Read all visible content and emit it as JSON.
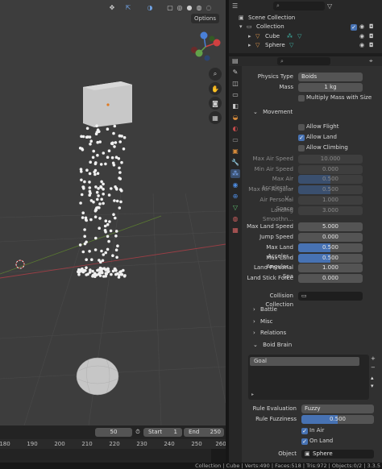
{
  "viewport": {
    "options_label": "Options"
  },
  "timeline": {
    "current_frame": "50",
    "start_label": "Start",
    "start_value": "1",
    "end_label": "End",
    "end_value": "250",
    "ticks": [
      "180",
      "190",
      "200",
      "210",
      "220",
      "230",
      "240",
      "250",
      "260"
    ]
  },
  "outliner": {
    "scene_collection": "Scene Collection",
    "collection": "Collection",
    "cube": "Cube",
    "sphere": "Sphere"
  },
  "properties": {
    "physics_type_label": "Physics Type",
    "physics_type_value": "Boids",
    "mass_label": "Mass",
    "mass_value": "1 kg",
    "multiply_mass": "Multiply Mass with Size",
    "movement_label": "Movement",
    "allow_flight": "Allow Flight",
    "allow_land": "Allow Land",
    "allow_climbing": "Allow Climbing",
    "air": [
      {
        "label": "Max Air Speed",
        "value": "10.000"
      },
      {
        "label": "Min Air Speed",
        "value": "0.000"
      },
      {
        "label": "Max Air Accelerat...",
        "value": "0.500"
      },
      {
        "label": "Max Air Angular V...",
        "value": "0.500"
      },
      {
        "label": "Air Personal Space",
        "value": "1.000"
      },
      {
        "label": "Landing Smoothn...",
        "value": "3.000"
      }
    ],
    "land": [
      {
        "label": "Max Land Speed",
        "value": "5.000"
      },
      {
        "label": "Jump Speed",
        "value": "0.000"
      },
      {
        "label": "Max Land Acceler...",
        "value": "0.500"
      },
      {
        "label": "Max Land Angular...",
        "value": "0.500"
      },
      {
        "label": "Land Personal Spa",
        "value": "1.000"
      },
      {
        "label": "Land Stick Force",
        "value": "0.000"
      }
    ],
    "collision_collection": "Collision Collection",
    "battle": "Battle",
    "misc": "Misc",
    "relations": "Relations",
    "boid_brain": "Boid Brain",
    "goal": "Goal",
    "rule_evaluation_label": "Rule Evaluation",
    "rule_evaluation_value": "Fuzzy",
    "rule_fuzziness_label": "Rule Fuzziness",
    "rule_fuzziness_value": "0.500",
    "in_air": "In Air",
    "on_land": "On Land",
    "object_label": "Object",
    "object_value": "Sphere"
  },
  "status": {
    "text": "Collection | Cube | Verts:490 | Faces:518 | Tris:972 | Objects:0/2 | 3.3.5"
  },
  "colors": {
    "accent": "#4772b3",
    "viewport_bg": "#3d3d3d",
    "panel_bg": "#303030"
  }
}
